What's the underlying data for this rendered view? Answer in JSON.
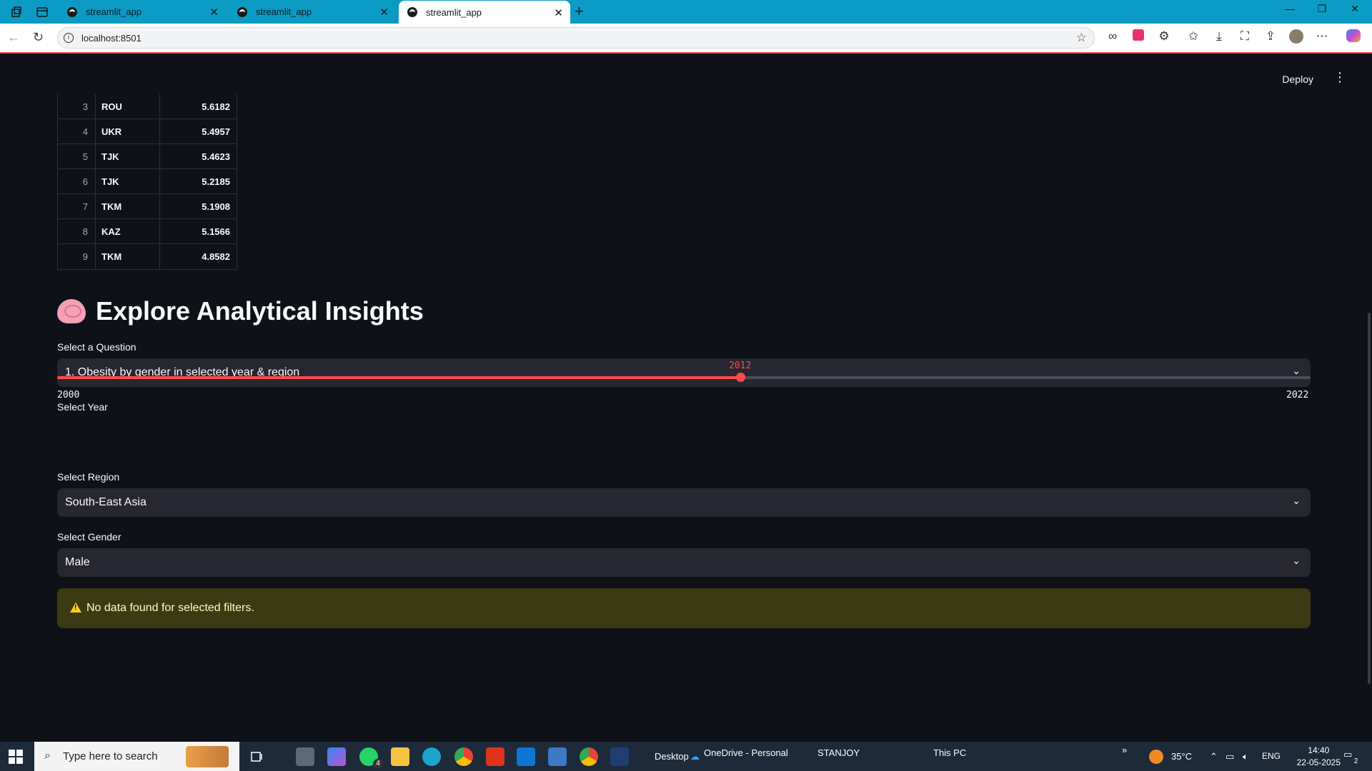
{
  "browser": {
    "tabs": [
      {
        "title": "streamlit_app"
      },
      {
        "title": "streamlit_app"
      },
      {
        "title": "streamlit_app"
      }
    ],
    "url": "localhost:8501"
  },
  "header": {
    "deploy_label": "Deploy"
  },
  "table": {
    "rows": [
      {
        "idx": "3",
        "code": "ROU",
        "value": "5.6182"
      },
      {
        "idx": "4",
        "code": "UKR",
        "value": "5.4957"
      },
      {
        "idx": "5",
        "code": "TJK",
        "value": "5.4623"
      },
      {
        "idx": "6",
        "code": "TJK",
        "value": "5.2185"
      },
      {
        "idx": "7",
        "code": "TKM",
        "value": "5.1908"
      },
      {
        "idx": "8",
        "code": "KAZ",
        "value": "5.1566"
      },
      {
        "idx": "9",
        "code": "TKM",
        "value": "4.8582"
      }
    ]
  },
  "insights": {
    "title": "Explore Analytical Insights",
    "question_label": "Select a Question",
    "question_value": "1. Obesity by gender in selected year & region",
    "year_label": "Select Year",
    "year_min": "2000",
    "year_max": "2022",
    "year_value": "2012",
    "year_fraction": 0.545,
    "region_label": "Select Region",
    "region_value": "South-East Asia",
    "gender_label": "Select Gender",
    "gender_value": "Male",
    "warning_text": "No data found for selected filters."
  },
  "taskbar": {
    "search_placeholder": "Type here to search",
    "desktop_label": "Desktop",
    "onedrive_label": "OneDrive - Personal",
    "user_label": "STANJOY",
    "thispc_label": "This PC",
    "weather": "35°C",
    "lang": "ENG",
    "time": "14:40",
    "date": "22-05-2025",
    "whatsapp_badge": "4",
    "notif_count": "2"
  },
  "colors": {
    "accent": "#ff4b4b",
    "warning_bg": "#3b3a12",
    "warning_text": "#ffffc2"
  }
}
